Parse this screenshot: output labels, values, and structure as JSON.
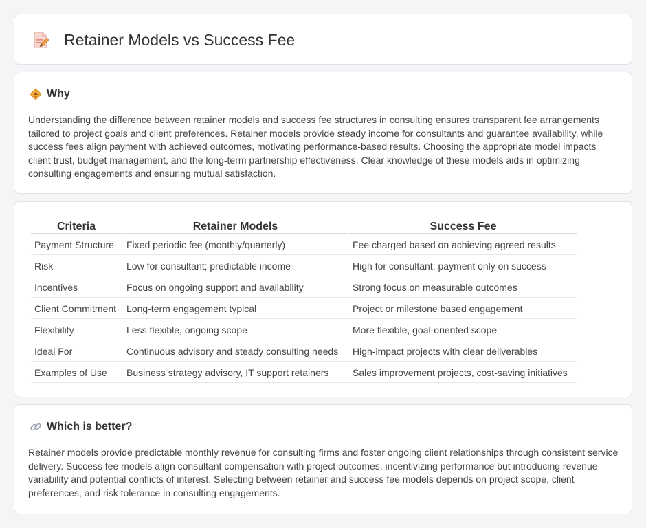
{
  "header": {
    "title": "Retainer Models vs Success Fee",
    "icon": "edit-document-icon"
  },
  "why": {
    "title": "Why",
    "icon": "diamond-warning-icon",
    "body": "Understanding the difference between retainer models and success fee structures in consulting ensures transparent fee arrangements tailored to project goals and client preferences. Retainer models provide steady income for consultants and guarantee availability, while success fees align payment with achieved outcomes, motivating performance-based results. Choosing the appropriate model impacts client trust, budget management, and the long-term partnership effectiveness. Clear knowledge of these models aids in optimizing consulting engagements and ensuring mutual satisfaction."
  },
  "table": {
    "headers": [
      "Criteria",
      "Retainer Models",
      "Success Fee"
    ],
    "rows": [
      [
        "Payment Structure",
        "Fixed periodic fee (monthly/quarterly)",
        "Fee charged based on achieving agreed results"
      ],
      [
        "Risk",
        "Low for consultant; predictable income",
        "High for consultant; payment only on success"
      ],
      [
        "Incentives",
        "Focus on ongoing support and availability",
        "Strong focus on measurable outcomes"
      ],
      [
        "Client Commitment",
        "Long-term engagement typical",
        "Project or milestone based engagement"
      ],
      [
        "Flexibility",
        "Less flexible, ongoing scope",
        "More flexible, goal-oriented scope"
      ],
      [
        "Ideal For",
        "Continuous advisory and steady consulting needs",
        "High-impact projects with clear deliverables"
      ],
      [
        "Examples of Use",
        "Business strategy advisory, IT support retainers",
        "Sales improvement projects, cost-saving initiatives"
      ]
    ]
  },
  "better": {
    "title": "Which is better?",
    "icon": "link-icon",
    "body": "Retainer models provide predictable monthly revenue for consulting firms and foster ongoing client relationships through consistent service delivery. Success fee models align consultant compensation with project outcomes, incentivizing performance but introducing revenue variability and potential conflicts of interest. Selecting between retainer and success fee models depends on project scope, client preferences, and risk tolerance in consulting engagements."
  },
  "colors": {
    "background": "#f5f5f7",
    "card": "#ffffff",
    "accent_orange": "#f0a030",
    "icon_pink": "#e86a6a"
  }
}
